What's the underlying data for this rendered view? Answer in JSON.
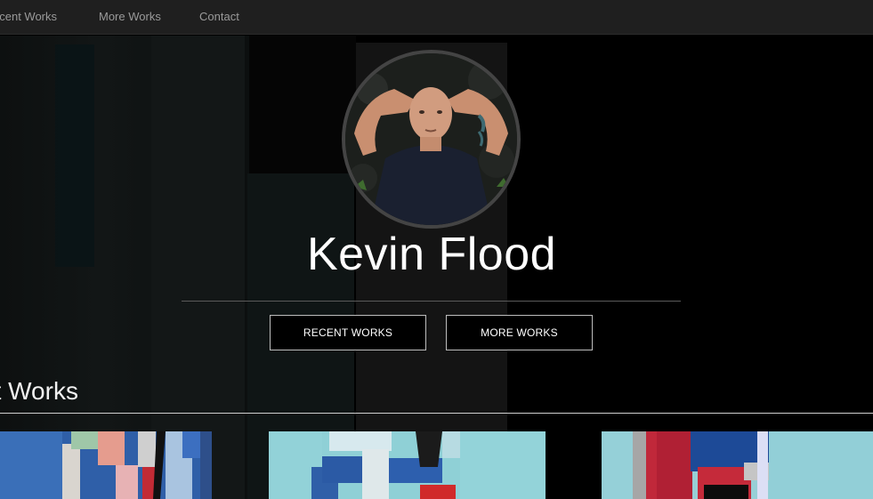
{
  "nav": {
    "items": [
      {
        "label": "ecent Works"
      },
      {
        "label": "More Works"
      },
      {
        "label": "Contact"
      }
    ]
  },
  "hero": {
    "title": "Kevin Flood",
    "buttons": {
      "recent": "RECENT WORKS",
      "more": "MORE WORKS"
    }
  },
  "section": {
    "title": "nt Works"
  },
  "colors": {
    "nav_bg": "#1f1f1f",
    "page_bg": "#000000",
    "button_border": "#bdbdbd"
  }
}
